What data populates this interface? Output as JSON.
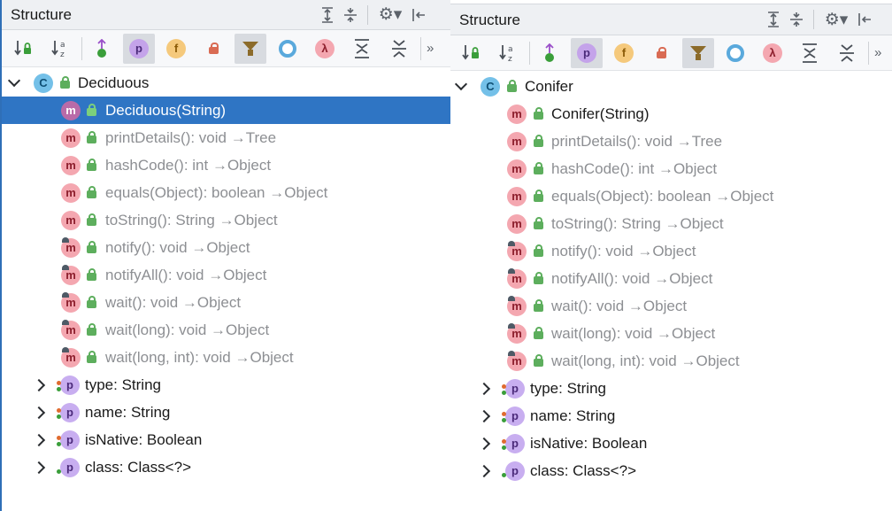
{
  "panels": [
    {
      "title": "Structure",
      "class_name": "Deciduous",
      "members": [
        {
          "name": "Deciduous(String)",
          "sig": "",
          "selected": true,
          "inherited": false
        },
        {
          "name": "printDetails()",
          "sig": ": void →Tree",
          "selected": false,
          "inherited": true
        },
        {
          "name": "hashCode()",
          "sig": ": int →Object",
          "selected": false,
          "inherited": true
        },
        {
          "name": "equals(Object)",
          "sig": ": boolean →Object",
          "selected": false,
          "inherited": true
        },
        {
          "name": "toString()",
          "sig": ": String →Object",
          "selected": false,
          "inherited": true
        },
        {
          "name": "notify()",
          "sig": ": void →Object",
          "selected": false,
          "inherited": true
        },
        {
          "name": "notifyAll()",
          "sig": ": void →Object",
          "selected": false,
          "inherited": true
        },
        {
          "name": "wait()",
          "sig": ": void →Object",
          "selected": false,
          "inherited": true
        },
        {
          "name": "wait(long)",
          "sig": ": void →Object",
          "selected": false,
          "inherited": true
        },
        {
          "name": "wait(long, int)",
          "sig": ": void →Object",
          "selected": false,
          "inherited": true
        }
      ],
      "properties": [
        {
          "label": "type: String"
        },
        {
          "label": "name: String"
        },
        {
          "label": "isNative: Boolean"
        },
        {
          "label": "class: Class<?>"
        }
      ]
    },
    {
      "title": "Structure",
      "class_name": "Conifer",
      "members": [
        {
          "name": "Conifer(String)",
          "sig": "",
          "selected": false,
          "inherited": false
        },
        {
          "name": "printDetails()",
          "sig": ": void →Tree",
          "selected": false,
          "inherited": true
        },
        {
          "name": "hashCode()",
          "sig": ": int →Object",
          "selected": false,
          "inherited": true
        },
        {
          "name": "equals(Object)",
          "sig": ": boolean →Object",
          "selected": false,
          "inherited": true
        },
        {
          "name": "toString()",
          "sig": ": String →Object",
          "selected": false,
          "inherited": true
        },
        {
          "name": "notify()",
          "sig": ": void →Object",
          "selected": false,
          "inherited": true
        },
        {
          "name": "notifyAll()",
          "sig": ": void →Object",
          "selected": false,
          "inherited": true
        },
        {
          "name": "wait()",
          "sig": ": void →Object",
          "selected": false,
          "inherited": true
        },
        {
          "name": "wait(long)",
          "sig": ": void →Object",
          "selected": false,
          "inherited": true
        },
        {
          "name": "wait(long, int)",
          "sig": ": void →Object",
          "selected": false,
          "inherited": true
        }
      ],
      "properties": [
        {
          "label": "type: String"
        },
        {
          "label": "name: String"
        },
        {
          "label": "isNative: Boolean"
        },
        {
          "label": "class: Class<?>"
        }
      ]
    }
  ],
  "icons": {
    "class_badge": "C",
    "method_badge": "m",
    "property_badge": "p",
    "toolbar_property_badge": "p",
    "toolbar_field_badge": "f",
    "toolbar_lambda_badge": "λ",
    "more": "»"
  },
  "colors": {
    "selection": "#2f75c4",
    "method_badge": "#f4a7b0",
    "property_badge": "#c8aef0",
    "class_badge": "#74c0e8",
    "access_lock": "#5dae5d",
    "inherited_text": "#8d8f93"
  }
}
